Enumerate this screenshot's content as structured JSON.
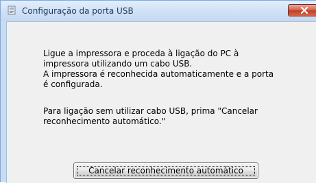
{
  "window": {
    "title": "Configuração da porta USB",
    "icon": "usb-config-icon",
    "close_icon": "close-icon"
  },
  "message": {
    "paragraph_1": "Ligue a impressora e proceda à ligação do PC à\nimpressora utilizando um cabo USB.\nA impressora é reconhecida automaticamente e a porta\né configurada.",
    "paragraph_2": "Para ligação sem utilizar cabo USB, prima \"Cancelar\nreconhecimento automático.\""
  },
  "buttons": {
    "cancel_auto_recognition": "Cancelar reconhecimento automático"
  },
  "colors": {
    "title_text": "#1e395b",
    "close_button": "#c13f26",
    "client_background": "#f0f0f0"
  }
}
